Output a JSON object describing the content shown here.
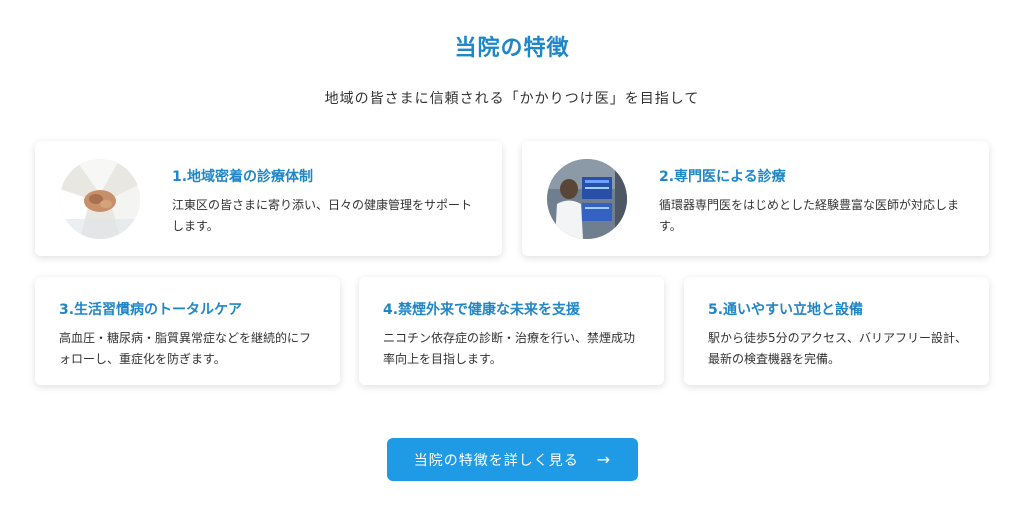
{
  "header": {
    "title": "当院の特徴",
    "subtitle": "地域の皆さまに信頼される「かかりつけ医」を目指して"
  },
  "features": [
    {
      "title": "1.地域密着の診療体制",
      "desc": "江東区の皆さまに寄り添い、日々の健康管理をサポートします。"
    },
    {
      "title": "2.専門医による診療",
      "desc": "循環器専門医をはじめとした経験豊富な医師が対応します。"
    },
    {
      "title": "3.生活習慣病のトータルケア",
      "desc": "高血圧・糖尿病・脂質異常症などを継続的にフォローし、重症化を防ぎます。"
    },
    {
      "title": "4.禁煙外来で健康な未来を支援",
      "desc": "ニコチン依存症の診断・治療を行い、禁煙成功率向上を目指します。"
    },
    {
      "title": "5.通いやすい立地と設備",
      "desc": "駅から徒歩5分のアクセス、バリアフリー設計、最新の検査機器を完備。"
    }
  ],
  "cta": {
    "label": "当院の特徴を詳しく見る",
    "icon": "arrow-right-icon"
  },
  "colors": {
    "accent": "#1f86c8",
    "button": "#1f9be6"
  }
}
